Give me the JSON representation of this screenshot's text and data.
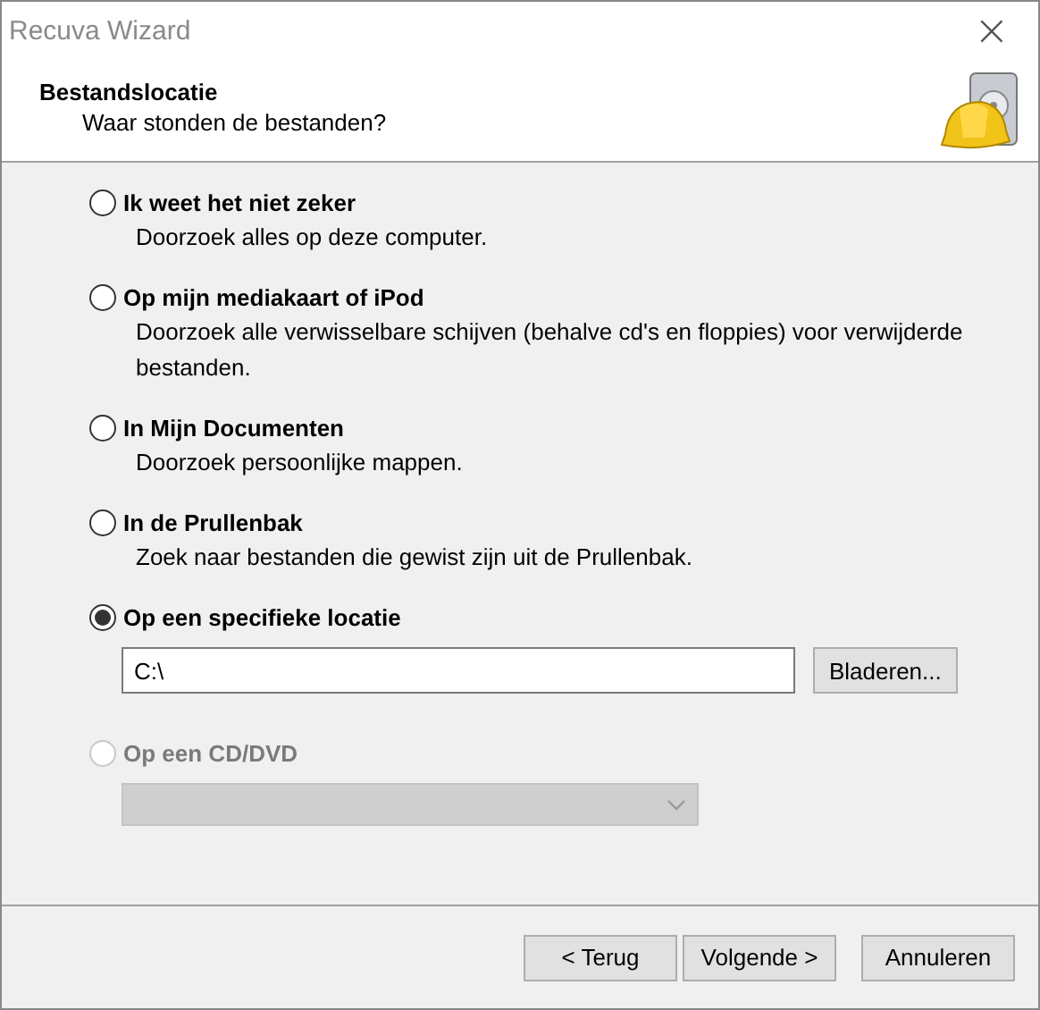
{
  "window": {
    "title": "Recuva Wizard",
    "close": "×"
  },
  "header": {
    "title": "Bestandslocatie",
    "subtitle": "Waar stonden de bestanden?"
  },
  "options": [
    {
      "kind": "plain",
      "label": "Ik weet het niet zeker",
      "description": "Doorzoek alles op deze computer.",
      "selected": false,
      "disabled": false
    },
    {
      "kind": "plain",
      "label": "Op mijn mediakaart of iPod",
      "description": "Doorzoek alle verwisselbare schijven (behalve cd's en floppies) voor verwijderde bestanden.",
      "selected": false,
      "disabled": false
    },
    {
      "kind": "plain",
      "label": "In Mijn Documenten",
      "description": "Doorzoek persoonlijke mappen.",
      "selected": false,
      "disabled": false
    },
    {
      "kind": "plain",
      "label": "In de Prullenbak",
      "description": "Zoek naar bestanden die gewist zijn uit de Prullenbak.",
      "selected": false,
      "disabled": false
    },
    {
      "kind": "path",
      "label": "Op een specifieke locatie",
      "value": "C:\\",
      "button": "Bladeren...",
      "selected": true,
      "disabled": false
    },
    {
      "kind": "drive",
      "label": "Op een CD/DVD",
      "selected": false,
      "disabled": true
    }
  ],
  "buttons": [
    {
      "label": "< Terug"
    },
    {
      "label": "Volgende >"
    },
    {
      "label": "Annuleren"
    }
  ]
}
